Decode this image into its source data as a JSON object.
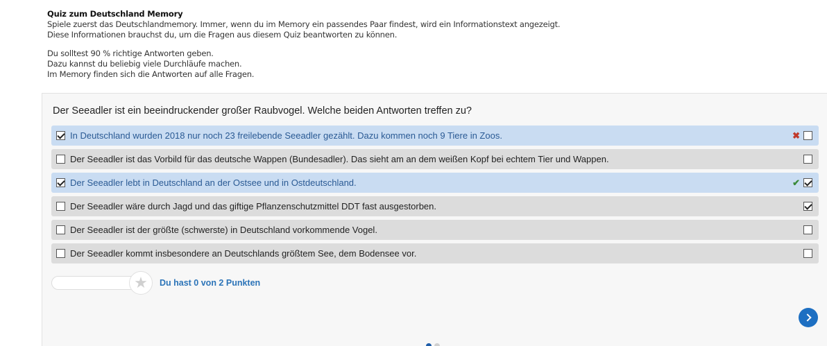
{
  "intro": {
    "title": "Quiz zum Deutschland Memory",
    "line1": "Spiele zuerst das Deutschlandmemory. Immer, wenn du im Memory ein passendes Paar findest, wird ein Informationstext angezeigt.",
    "line2": "Diese Informationen brauchst du, um die Fragen aus diesem Quiz beantworten zu können.",
    "line3": "Du solltest 90 % richtige Antworten geben.",
    "line4": "Dazu kannst du beliebig viele Durchläufe machen.",
    "line5": "Im Memory finden sich die Antworten auf alle Fragen."
  },
  "quiz": {
    "question": "Der Seeadler ist ein beeindruckender großer Raubvogel. Welche beiden Antworten treffen zu?",
    "answers": [
      {
        "text": "In Deutschland wurden 2018 nur noch 23 freilebende Seeadler gezählt. Dazu kommen noch 9 Tiere in Zoos.",
        "selected": true,
        "feedback": "wrong",
        "feedback_glyph": "✖",
        "solution_checked": false
      },
      {
        "text": "Der Seeadler ist das Vorbild für das deutsche Wappen (Bundesadler). Das sieht am an dem weißen Kopf bei echtem Tier und Wappen.",
        "selected": false,
        "feedback": "",
        "feedback_glyph": "",
        "solution_checked": false
      },
      {
        "text": "Der Seeadler lebt in Deutschland an der Ostsee und in Ostdeutschland.",
        "selected": true,
        "feedback": "correct",
        "feedback_glyph": "✔",
        "solution_checked": true
      },
      {
        "text": "Der Seeadler wäre durch Jagd und das giftige Pflanzenschutzmittel DDT fast ausgestorben.",
        "selected": false,
        "feedback": "",
        "feedback_glyph": "",
        "solution_checked": true
      },
      {
        "text": "Der Seeadler ist der größte (schwerste) in Deutschland vorkommende Vogel.",
        "selected": false,
        "feedback": "",
        "feedback_glyph": "",
        "solution_checked": false
      },
      {
        "text": "Der Seeadler kommt insbesondere an Deutschlands größtem See, dem Bodensee vor.",
        "selected": false,
        "feedback": "",
        "feedback_glyph": "",
        "solution_checked": false
      }
    ],
    "score_text": "Du hast 0 von 2 Punkten",
    "score_progress": 0,
    "star_glyph": "★",
    "pagination": {
      "current": 1,
      "total": 2
    }
  },
  "colors": {
    "accent": "#1d6fc2",
    "selected_row": "#c9dcf2",
    "row": "#dcdcdc",
    "wrong": "#c0392b",
    "correct": "#3a8a3a"
  }
}
